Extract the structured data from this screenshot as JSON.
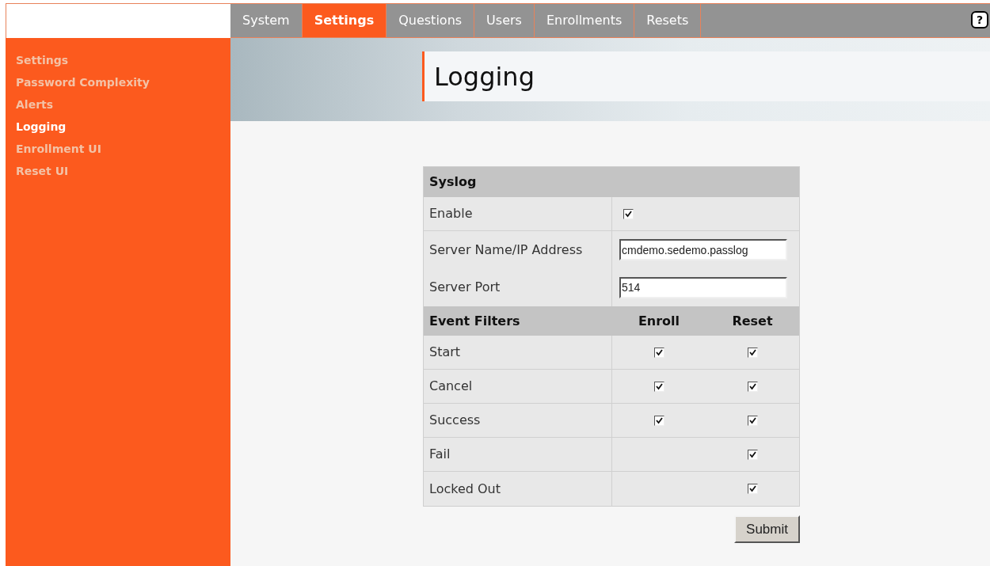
{
  "tabs": [
    {
      "label": "System",
      "selected": false
    },
    {
      "label": "Settings",
      "selected": true
    },
    {
      "label": "Questions",
      "selected": false
    },
    {
      "label": "Users",
      "selected": false
    },
    {
      "label": "Enrollments",
      "selected": false
    },
    {
      "label": "Resets",
      "selected": false
    }
  ],
  "help_button": {
    "label": "?"
  },
  "sidebar": {
    "items": [
      {
        "label": "Settings",
        "selected": false
      },
      {
        "label": "Password Complexity",
        "selected": false
      },
      {
        "label": "Alerts",
        "selected": false
      },
      {
        "label": "Logging",
        "selected": true
      },
      {
        "label": "Enrollment UI",
        "selected": false
      },
      {
        "label": "Reset UI",
        "selected": false
      }
    ]
  },
  "page_title": "Logging",
  "syslog": {
    "heading": "Syslog",
    "enable_label": "Enable",
    "enable_checked": true,
    "server_label": "Server Name/IP Address",
    "server_value": "cmdemo.sedemo.passlog",
    "port_label": "Server Port",
    "port_value": "514"
  },
  "event_filters": {
    "columns": [
      "Event Filters",
      "Enroll",
      "Reset"
    ],
    "rows": [
      {
        "label": "Start",
        "enroll_checked": true,
        "reset_checked": true
      },
      {
        "label": "Cancel",
        "enroll_checked": true,
        "reset_checked": true
      },
      {
        "label": "Success",
        "enroll_checked": true,
        "reset_checked": true
      },
      {
        "label": "Fail",
        "reset_checked": true
      },
      {
        "label": "Locked Out",
        "reset_checked": true
      }
    ]
  },
  "submit_button": "Submit"
}
